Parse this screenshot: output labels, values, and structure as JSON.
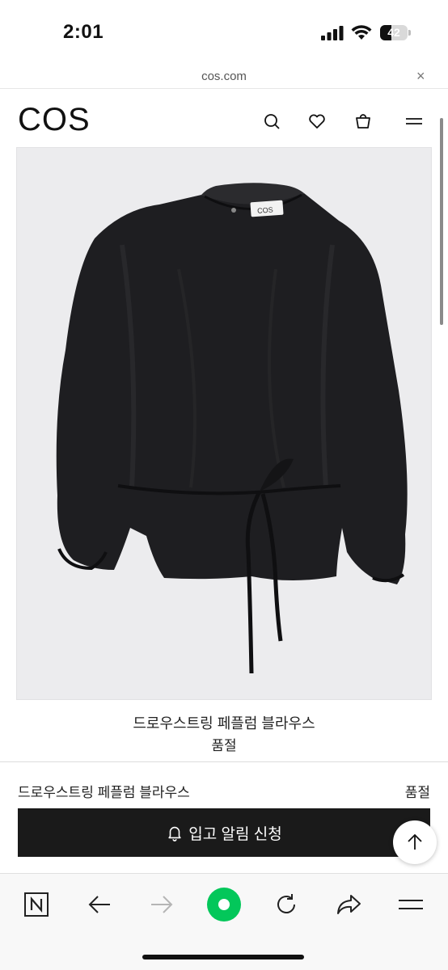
{
  "status_bar": {
    "time": "2:01",
    "battery_level": "42",
    "battery_fraction": 0.42
  },
  "browser": {
    "url": "cos.com",
    "close_icon": "×"
  },
  "header": {
    "logo": "COS",
    "icons": [
      "search-icon",
      "heart-icon",
      "shopping-bag-icon",
      "menu-icon"
    ]
  },
  "product": {
    "image_alt": "",
    "name": "드로우스트링 페플럼 블라우스",
    "status": "품절"
  },
  "sticky_bar": {
    "name": "드로우스트링 페플럼 블라우스",
    "status": "품절",
    "notify_label": "입고 알림 신청",
    "notify_icon": "bell-icon"
  },
  "scroll_top_icon": "arrow-up-icon",
  "toolbar": {
    "items": [
      "naver-n-icon",
      "back-arrow-icon",
      "forward-arrow-icon",
      "green-home-icon",
      "reload-icon",
      "share-icon",
      "menu-icon"
    ],
    "accent_color": "#03c75a"
  }
}
